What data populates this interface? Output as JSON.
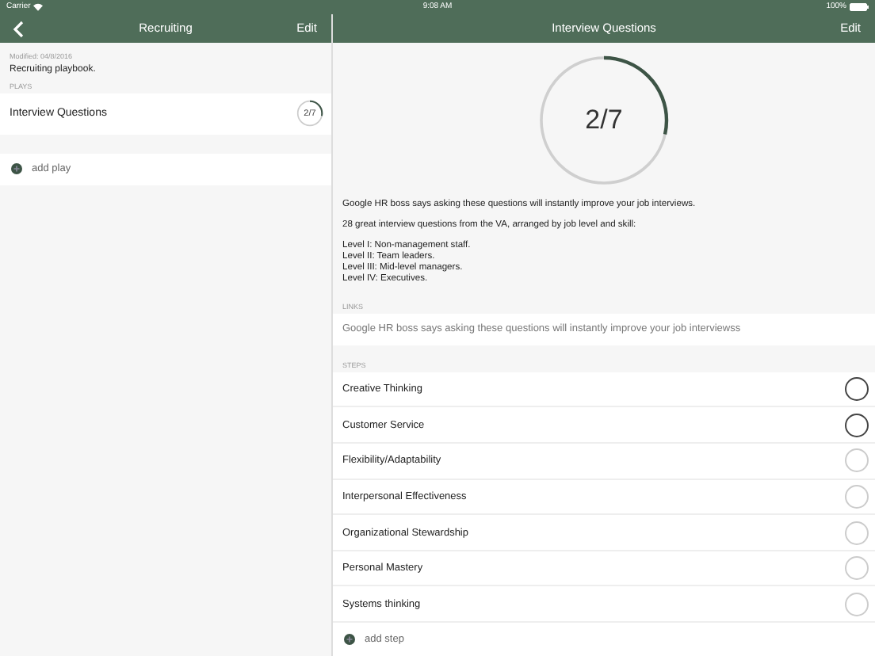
{
  "status_bar": {
    "carrier": "Carrier",
    "time": "9:08 AM",
    "battery": "100%"
  },
  "playbook": {
    "nav": {
      "title": "Recruiting",
      "edit": "Edit"
    },
    "modified": "Modified: 04/8/2016",
    "description": "Recruiting playbook.",
    "plays_header": "PLAYS",
    "plays": [
      {
        "name": "Interview Questions",
        "progress": "2/7",
        "level": 0.2857
      }
    ],
    "add_play": "add play"
  },
  "play": {
    "nav": {
      "title": "Interview Questions",
      "edit": "Edit"
    },
    "progress": {
      "text": "2/7",
      "level": 0.2857
    },
    "paragraphs": [
      [
        "Google HR boss says asking these questions will instantly improve your job interviews."
      ],
      [
        "28 great interview questions from the VA, arranged by job level and skill:"
      ],
      [
        "Level I: Non-management staff.",
        "Level II: Team leaders.",
        "Level III: Mid-level managers.",
        "Level IV: Executives."
      ]
    ],
    "links_header": "LINKS",
    "links": [
      "Google HR boss says asking these questions will instantly improve your job interviewss"
    ],
    "steps_header": "STEPS",
    "steps": [
      {
        "name": "Creative Thinking",
        "completed": true
      },
      {
        "name": "Customer Service",
        "completed": true
      },
      {
        "name": "Flexibility/Adaptability",
        "completed": false
      },
      {
        "name": "Interpersonal Effectiveness",
        "completed": false
      },
      {
        "name": "Organizational Stewardship",
        "completed": false
      },
      {
        "name": "Personal Mastery",
        "completed": false
      },
      {
        "name": "Systems thinking",
        "completed": false
      }
    ],
    "add_step": "add step"
  }
}
